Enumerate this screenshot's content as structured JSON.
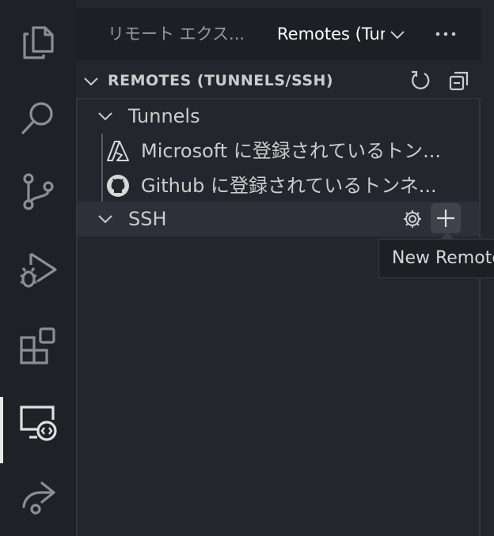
{
  "activity_bar": {
    "items": [
      {
        "name": "explorer",
        "icon": "files-icon",
        "active": false
      },
      {
        "name": "search",
        "icon": "search-icon",
        "active": false
      },
      {
        "name": "source-control",
        "icon": "source-control-icon",
        "active": false
      },
      {
        "name": "run-and-debug",
        "icon": "run-debug-icon",
        "active": false
      },
      {
        "name": "extensions",
        "icon": "extensions-icon",
        "active": false
      },
      {
        "name": "remote-explorer",
        "icon": "remote-explorer-icon",
        "active": true
      },
      {
        "name": "live-share",
        "icon": "live-share-icon",
        "active": false
      }
    ]
  },
  "tabs": {
    "tab1_label": "リモート エクス...",
    "tab2_label": "Remotes (Tunnels/SSH)",
    "more_icon": "ellipsis-icon",
    "dropdown_icon": "chevron-down-icon"
  },
  "section": {
    "title": "REMOTES (TUNNELS/SSH)",
    "actions": [
      "refresh-icon",
      "collapse-all-icon"
    ]
  },
  "tree": {
    "tunnels_label": "Tunnels",
    "microsoft_label": "Microsoft に登録されているトン...",
    "github_label": "Github に登録されているトンネ...",
    "ssh_label": "SSH",
    "ssh_actions": [
      "gear-icon",
      "plus-icon"
    ]
  },
  "tooltip": {
    "text": "New Remote"
  },
  "colors": {
    "activity_bg": "#1f2126",
    "sidebar_bg": "#23262d",
    "tab_strip_bg": "#1d1f25",
    "selected_row_bg": "#2d3038",
    "icon_color": "#8b8e94",
    "text_color": "#cccccc"
  }
}
